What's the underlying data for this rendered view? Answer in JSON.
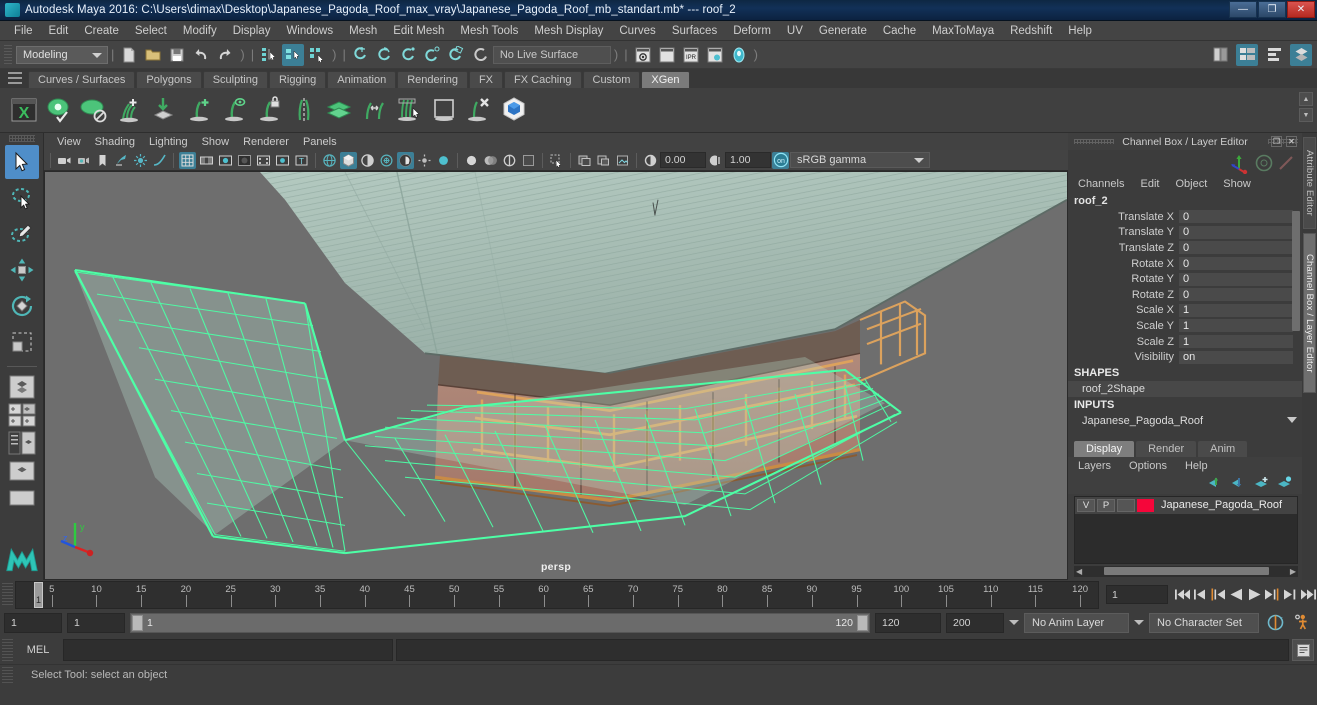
{
  "window": {
    "title": "Autodesk Maya 2016: C:\\Users\\dimax\\Desktop\\Japanese_Pagoda_Roof_max_vray\\Japanese_Pagoda_Roof_mb_standart.mb*  ---  roof_2",
    "minimize": "—",
    "maximize": "❐",
    "close": "✕"
  },
  "menubar": {
    "items": [
      {
        "label": "File"
      },
      {
        "label": "Edit"
      },
      {
        "label": "Create"
      },
      {
        "label": "Select"
      },
      {
        "label": "Modify"
      },
      {
        "label": "Display"
      },
      {
        "label": "Windows"
      },
      {
        "label": "Mesh"
      },
      {
        "label": "Edit Mesh"
      },
      {
        "label": "Mesh Tools"
      },
      {
        "label": "Mesh Display"
      },
      {
        "label": "Curves"
      },
      {
        "label": "Surfaces"
      },
      {
        "label": "Deform"
      },
      {
        "label": "UV"
      },
      {
        "label": "Generate"
      },
      {
        "label": "Cache"
      },
      {
        "label": "MaxToMaya"
      },
      {
        "label": "Redshift"
      },
      {
        "label": "Help"
      }
    ]
  },
  "statusline": {
    "menu_set": "Modeling",
    "live_surface": "No Live Surface",
    "icons": [
      "new-scene-icon",
      "open-scene-icon",
      "save-scene-icon",
      "undo-icon",
      "redo-icon",
      "select-by-hierarchy-icon",
      "select-by-object-type-icon",
      "select-by-component-type-icon",
      "snap-to-grid-icon",
      "snap-to-curve-icon",
      "snap-to-point-icon",
      "snap-to-projected-center-icon",
      "snap-to-view-plane-icon",
      "make-live-icon",
      "render-current-frame-icon",
      "irpr-render-icon",
      "ipr-render-icon",
      "render-settings-icon",
      "hypershade-icon",
      "show-hide-editors-icon",
      "show-hide-attribute-editor-icon",
      "show-hide-tool-settings-icon",
      "show-hide-channel-box-icon"
    ]
  },
  "shelf": {
    "tabs": [
      {
        "label": "Curves / Surfaces",
        "active": false
      },
      {
        "label": "Polygons",
        "active": false
      },
      {
        "label": "Sculpting",
        "active": false
      },
      {
        "label": "Rigging",
        "active": false
      },
      {
        "label": "Animation",
        "active": false
      },
      {
        "label": "Rendering",
        "active": false
      },
      {
        "label": "FX",
        "active": false
      },
      {
        "label": "FX Caching",
        "active": false
      },
      {
        "label": "Custom",
        "active": false
      },
      {
        "label": "XGen",
        "active": true
      }
    ],
    "icons": [
      "xgen-window-icon",
      "xgen-preview-icon",
      "xgen-display-off-icon",
      "xgen-add-description-icon",
      "xgen-import-collection-icon",
      "xgen-add-guide-icon",
      "xgen-show-guide-icon",
      "xgen-freeze-guide-icon",
      "xgen-mirror-guide-icon",
      "xgen-layer-icon",
      "xgen-move-guide-icon",
      "xgen-select-guide-icon",
      "xgen-region-icon",
      "xgen-delete-guide-icon",
      "xgen-interactive-groom-icon"
    ]
  },
  "toolbox": {
    "tools": [
      {
        "name": "select-tool",
        "selected": true
      },
      {
        "name": "lasso-select-tool",
        "selected": false
      },
      {
        "name": "paint-select-tool",
        "selected": false
      },
      {
        "name": "move-tool",
        "selected": false
      },
      {
        "name": "rotate-tool",
        "selected": false
      },
      {
        "name": "scale-tool",
        "selected": false
      }
    ],
    "layout_icons": [
      "single-perspective-layout-icon",
      "four-view-layout-icon",
      "outliner-persp-layout-icon",
      "persp-graph-layout-icon",
      "hypershade-persp-layout-icon"
    ]
  },
  "viewport": {
    "menu": [
      {
        "label": "View"
      },
      {
        "label": "Shading"
      },
      {
        "label": "Lighting"
      },
      {
        "label": "Show"
      },
      {
        "label": "Renderer"
      },
      {
        "label": "Panels"
      }
    ],
    "camera_label": "persp",
    "exposure": "0.00",
    "gamma_value": "1.00",
    "color_management": "sRGB gamma",
    "toolbar_icons": [
      "select-camera-icon",
      "bookmarks-icon",
      "image-plane-icon",
      "two-sided-lighting-icon",
      "shadows-icon",
      "grid-icon",
      "film-gate-icon",
      "resolution-gate-icon",
      "gate-mask-icon",
      "xray-icon",
      "xray-joints-icon",
      "texture-icon",
      "wireframe-icon",
      "smooth-shade-all-icon",
      "hardware-texturing-icon",
      "use-default-lighting-icon",
      "shadows-toggle-icon",
      "screen-space-ao-icon",
      "motion-blur-icon",
      "multisample-icon",
      "depth-of-field-icon",
      "isolate-select-icon",
      "xray-mode-icon",
      "exposure-icon",
      "gamma-icon",
      "color-management-icon"
    ]
  },
  "channel_box": {
    "panel_title": "Channel Box / Layer Editor",
    "menu": [
      {
        "label": "Channels"
      },
      {
        "label": "Edit"
      },
      {
        "label": "Object"
      },
      {
        "label": "Show"
      }
    ],
    "object_name": "roof_2",
    "attributes": [
      {
        "label": "Translate X",
        "value": "0"
      },
      {
        "label": "Translate Y",
        "value": "0"
      },
      {
        "label": "Translate Z",
        "value": "0"
      },
      {
        "label": "Rotate X",
        "value": "0"
      },
      {
        "label": "Rotate Y",
        "value": "0"
      },
      {
        "label": "Rotate Z",
        "value": "0"
      },
      {
        "label": "Scale X",
        "value": "1"
      },
      {
        "label": "Scale Y",
        "value": "1"
      },
      {
        "label": "Scale Z",
        "value": "1"
      },
      {
        "label": "Visibility",
        "value": "on"
      }
    ],
    "shapes_header": "SHAPES",
    "shapes_item": "roof_2Shape",
    "inputs_header": "INPUTS",
    "inputs_item": "Japanese_Pagoda_Roof",
    "vertical_tabs": [
      {
        "label": "Attribute Editor",
        "active": false
      },
      {
        "label": "Channel Box / Layer Editor",
        "active": true
      }
    ]
  },
  "layer_editor": {
    "tabs": [
      {
        "label": "Display",
        "active": true
      },
      {
        "label": "Render",
        "active": false
      },
      {
        "label": "Anim",
        "active": false
      }
    ],
    "menu": [
      {
        "label": "Layers"
      },
      {
        "label": "Options"
      },
      {
        "label": "Help"
      }
    ],
    "toolbar_icons": [
      "move-layer-up-icon",
      "move-layer-down-icon",
      "new-layer-icon",
      "new-layer-from-selected-icon"
    ],
    "layers": [
      {
        "visibility": "V",
        "playback": "P",
        "shading": "",
        "color": "#f5063a",
        "name": "Japanese_Pagoda_Roof"
      }
    ]
  },
  "timeline": {
    "ticks": [
      5,
      10,
      15,
      20,
      25,
      30,
      35,
      40,
      45,
      50,
      55,
      60,
      65,
      70,
      75,
      80,
      85,
      90,
      95,
      100,
      105,
      110,
      115,
      120
    ],
    "current_frame": "1",
    "current_frame_field": "1",
    "playback_buttons": [
      "go-to-start-icon",
      "step-back-keyframe-icon",
      "step-back-frame-icon",
      "play-backwards-icon",
      "play-forwards-icon",
      "step-forward-frame-icon",
      "step-forward-keyframe-icon",
      "go-to-end-icon"
    ]
  },
  "range": {
    "anim_start": "1",
    "range_start": "1",
    "slider_left_label": "1",
    "slider_right_label": "120",
    "range_end": "120",
    "anim_end": "200",
    "anim_layer": "No Anim Layer",
    "character_set": "No Character Set",
    "auto_key_icon": "auto-keyframe-icon",
    "anim_prefs_icon": "animation-preferences-icon"
  },
  "command_line": {
    "language": "MEL",
    "input_value": "",
    "output_value": "",
    "script_editor_icon": "script-editor-icon"
  },
  "status_bar": {
    "help_text": "Select Tool: select an object"
  },
  "colors": {
    "accent_blue": "#3c7f96",
    "selection_green": "#4dffa6",
    "wood_orange": "#d99247",
    "roof_gray": "#a8bdb5",
    "viewport_bg": "#6e6e6e",
    "layer_red": "#f5063a"
  }
}
